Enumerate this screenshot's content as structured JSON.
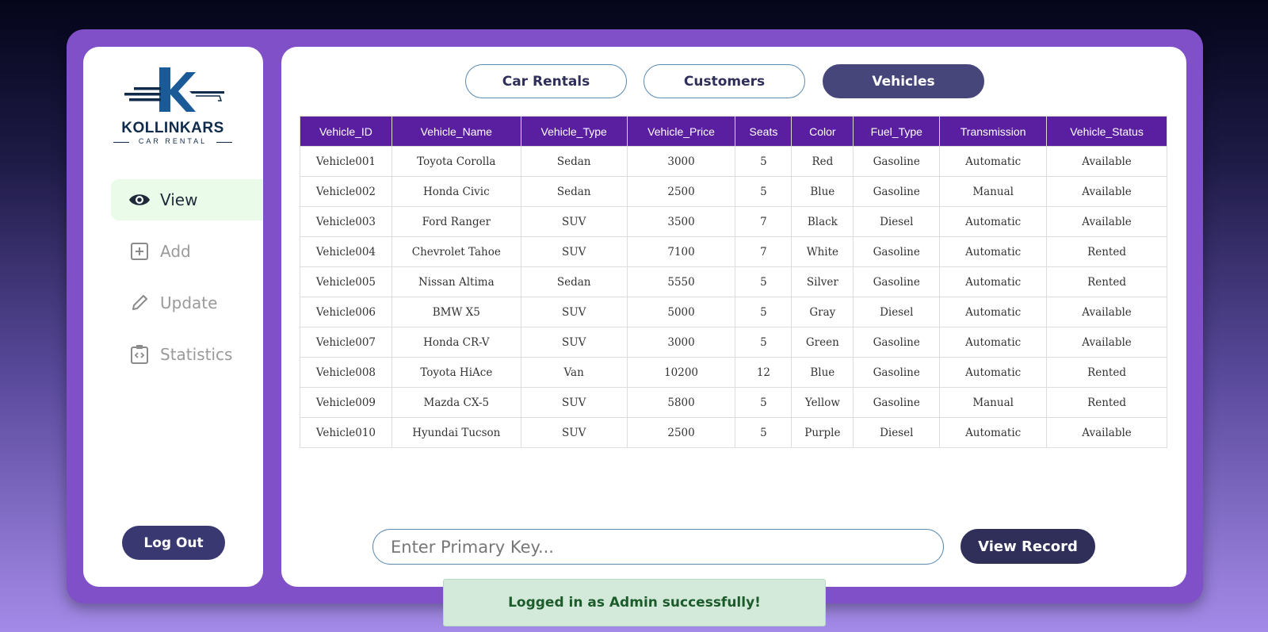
{
  "brand": {
    "name": "KOLLINKARS",
    "tagline": "CAR RENTAL"
  },
  "sidebar": {
    "items": [
      {
        "label": "View",
        "icon": "eye-icon",
        "active": true
      },
      {
        "label": "Add",
        "icon": "plus-square-icon",
        "active": false
      },
      {
        "label": "Update",
        "icon": "pencil-icon",
        "active": false
      },
      {
        "label": "Statistics",
        "icon": "clipboard-code-icon",
        "active": false
      }
    ],
    "logout_label": "Log Out"
  },
  "tabs": [
    {
      "label": "Car Rentals",
      "active": false
    },
    {
      "label": "Customers",
      "active": false
    },
    {
      "label": "Vehicles",
      "active": true
    }
  ],
  "table": {
    "columns": [
      "Vehicle_ID",
      "Vehicle_Name",
      "Vehicle_Type",
      "Vehicle_Price",
      "Seats",
      "Color",
      "Fuel_Type",
      "Transmission",
      "Vehicle_Status"
    ],
    "rows": [
      [
        "Vehicle001",
        "Toyota Corolla",
        "Sedan",
        "3000",
        "5",
        "Red",
        "Gasoline",
        "Automatic",
        "Available"
      ],
      [
        "Vehicle002",
        "Honda Civic",
        "Sedan",
        "2500",
        "5",
        "Blue",
        "Gasoline",
        "Manual",
        "Available"
      ],
      [
        "Vehicle003",
        "Ford Ranger",
        "SUV",
        "3500",
        "7",
        "Black",
        "Diesel",
        "Automatic",
        "Available"
      ],
      [
        "Vehicle004",
        "Chevrolet Tahoe",
        "SUV",
        "7100",
        "7",
        "White",
        "Gasoline",
        "Automatic",
        "Rented"
      ],
      [
        "Vehicle005",
        "Nissan Altima",
        "Sedan",
        "5550",
        "5",
        "Silver",
        "Gasoline",
        "Automatic",
        "Rented"
      ],
      [
        "Vehicle006",
        "BMW X5",
        "SUV",
        "5000",
        "5",
        "Gray",
        "Diesel",
        "Automatic",
        "Available"
      ],
      [
        "Vehicle007",
        "Honda CR-V",
        "SUV",
        "3000",
        "5",
        "Green",
        "Gasoline",
        "Automatic",
        "Available"
      ],
      [
        "Vehicle008",
        "Toyota HiAce",
        "Van",
        "10200",
        "12",
        "Blue",
        "Gasoline",
        "Automatic",
        "Rented"
      ],
      [
        "Vehicle009",
        "Mazda CX-5",
        "SUV",
        "5800",
        "5",
        "Yellow",
        "Gasoline",
        "Manual",
        "Rented"
      ],
      [
        "Vehicle010",
        "Hyundai Tucson",
        "SUV",
        "2500",
        "5",
        "Purple",
        "Diesel",
        "Automatic",
        "Available"
      ]
    ]
  },
  "search": {
    "placeholder": "Enter Primary Key...",
    "value": ""
  },
  "view_record_label": "View Record",
  "toast": {
    "message": "Logged in as Admin successfully!"
  },
  "colors": {
    "frame": "#8050c8",
    "header": "#5a1ea0",
    "active_tab": "#47467a",
    "button": "#2f2f5a",
    "active_nav_bg": "#eafbea",
    "toast_bg": "#d3eadb",
    "toast_text": "#1c5b2a"
  }
}
